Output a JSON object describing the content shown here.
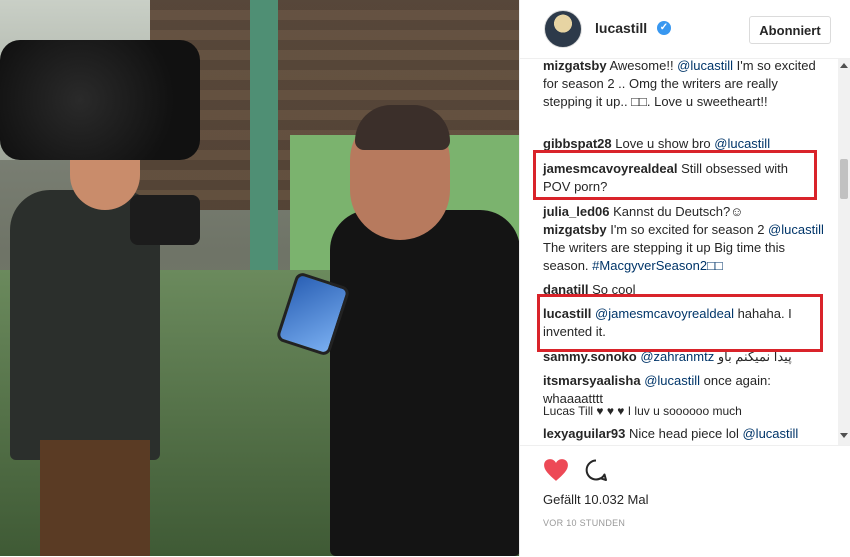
{
  "post": {
    "username": "lucastill",
    "follow_label": "Abonniert",
    "likes_text": "Gefällt 10.032 Mal",
    "timestamp": "VOR 10 STUNDEN"
  },
  "comments": [
    {
      "user": "mizgatsby",
      "mention": "@lucastill",
      "text_before": "Awesome!! ",
      "text_after": " I'm so excited for season 2 .. Omg the writers are really stepping it up.. □□. Love u sweetheart!!"
    },
    {
      "user": "gibbspat28",
      "mention": "@lucastill",
      "text_before": "Love u show bro ",
      "text_after": ""
    },
    {
      "user": "jamesmcavoyrealdeal",
      "mention": "",
      "text_before": "Still obsessed with POV porn?",
      "text_after": ""
    },
    {
      "user": "julia_led06",
      "mention": "",
      "text_before": "Kannst du Deutsch?☺",
      "text_after": ""
    },
    {
      "user": "mizgatsby",
      "mention": "@lucastill",
      "text_before": "I'm so excited for season 2 ",
      "text_after": " The writers are stepping it up Big time this season. ",
      "hashtag": "#MacgyverSeason2□□"
    },
    {
      "user": "danatill",
      "mention": "",
      "text_before": "So cool",
      "text_after": ""
    },
    {
      "user": "lucastill",
      "mention": "@jamesmcavoyrealdeal",
      "text_before": "",
      "text_after": " hahaha. I invented it."
    },
    {
      "user": "sammy.sonoko",
      "mention": "@zahranmtz",
      "text_before": "",
      "text_after": " پیدا نمیکنم باو"
    },
    {
      "user": "itsmarsyaalisha",
      "mention": "@lucastill",
      "text_before": "",
      "text_after": " once again: whaaaatttt"
    },
    {
      "user": "Lucas Till",
      "mention": "",
      "text_before": "♥ ♥ ♥ I luv u soooooo much",
      "text_after": ""
    },
    {
      "user": "lexyaguilar93",
      "mention": "@lucastill",
      "text_before": "Nice head piece lol ",
      "text_after": ""
    }
  ],
  "icons": {
    "heart": "heart-icon",
    "comment": "comment-icon",
    "verified": "verified-badge-icon"
  },
  "colors": {
    "highlight": "#d9232a",
    "like": "#ed4956",
    "link": "#003569",
    "verified": "#3897f0"
  }
}
